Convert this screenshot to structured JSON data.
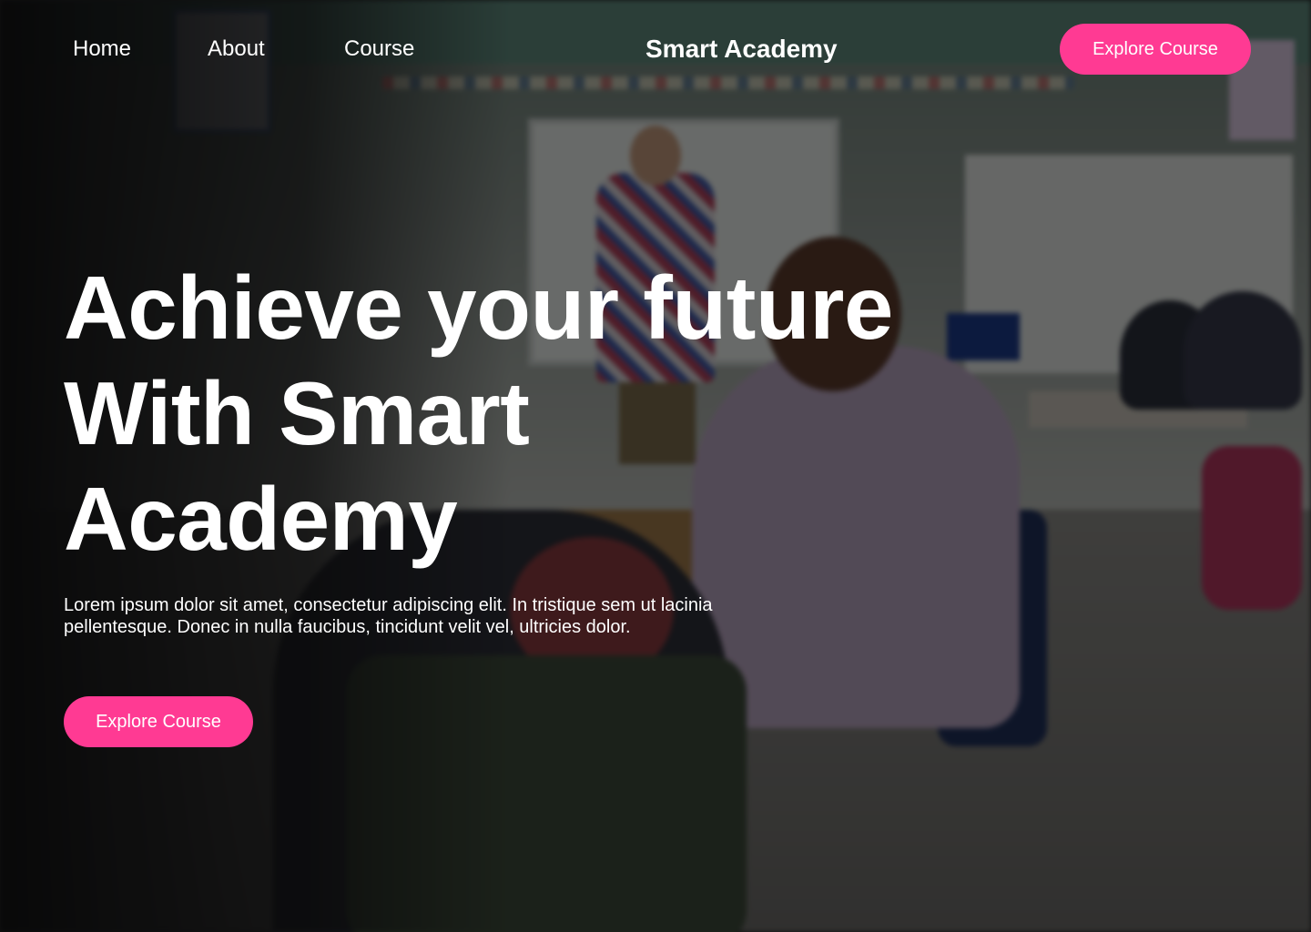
{
  "nav": {
    "links": [
      {
        "label": "Home"
      },
      {
        "label": "About"
      },
      {
        "label": "Course"
      }
    ],
    "brand": "Smart Academy",
    "cta_label": "Explore Course"
  },
  "hero": {
    "title_lines": [
      "Achieve your future",
      "With Smart",
      "Academy"
    ],
    "description": "Lorem ipsum dolor sit amet, consectetur adipiscing elit. In tristique sem ut lacinia pellentesque. Donec in nulla faucibus, tincidunt velit vel, ultricies dolor.",
    "cta_label": "Explore Course",
    "background": "classroom-photo"
  },
  "colors": {
    "accent": "#ff3a93",
    "text": "#ffffff",
    "overlay": "#000000"
  }
}
